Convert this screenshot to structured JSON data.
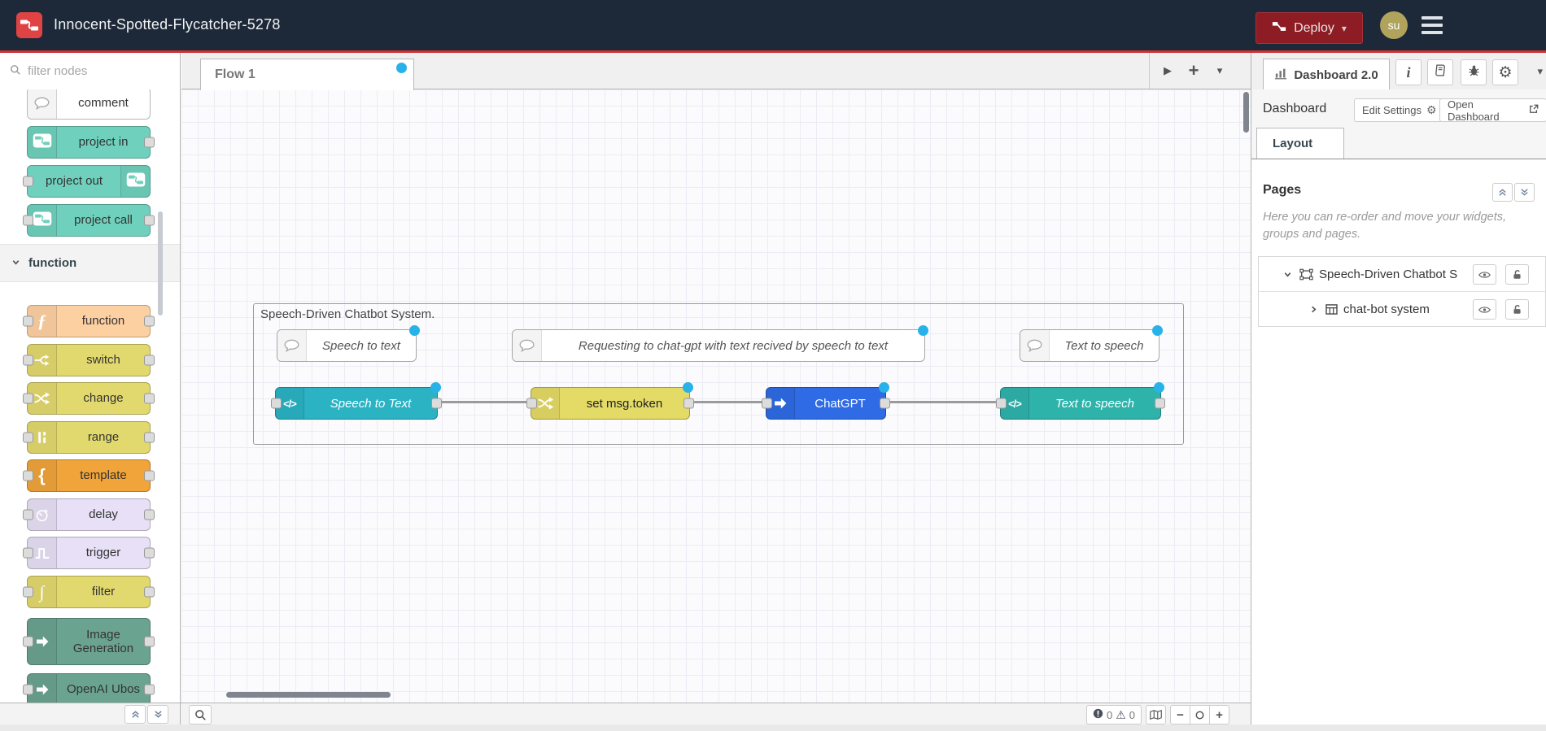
{
  "header": {
    "title": "Innocent-Spotted-Flycatcher-5278",
    "deploy_label": "Deploy",
    "avatar_initials": "su",
    "colors": {
      "bar": "#1d2939",
      "accent_red": "#cf3434",
      "deploy_bg": "#8e1c24"
    }
  },
  "palette": {
    "filter_placeholder": "filter nodes",
    "items": [
      {
        "label": "comment",
        "color": "#ffffff",
        "icon": "speech-bubble-icon",
        "icon_side": "left",
        "in": false,
        "out": false,
        "kind": "comment"
      },
      {
        "label": "project in",
        "color": "#6fd1bd",
        "icon": "node-red-icon",
        "icon_side": "left",
        "in": false,
        "out": true
      },
      {
        "label": "project out",
        "color": "#6fd1bd",
        "icon": "node-red-icon",
        "icon_side": "right",
        "in": true,
        "out": false
      },
      {
        "label": "project call",
        "color": "#6fd1bd",
        "icon": "node-red-icon",
        "icon_side": "left",
        "in": true,
        "out": true
      },
      {
        "header": "function"
      },
      {
        "label": "function",
        "color": "#fdd0a2",
        "icon": "function-icon",
        "icon_side": "left",
        "in": true,
        "out": true
      },
      {
        "label": "switch",
        "color": "#e2d96e",
        "icon": "switch-icon",
        "icon_side": "left",
        "in": true,
        "out": true
      },
      {
        "label": "change",
        "color": "#e2d96e",
        "icon": "change-icon",
        "icon_side": "left",
        "in": true,
        "out": true
      },
      {
        "label": "range",
        "color": "#e2d96e",
        "icon": "range-icon",
        "icon_side": "left",
        "in": true,
        "out": true
      },
      {
        "label": "template",
        "color": "#f0a43a",
        "icon": "template-icon",
        "icon_side": "left",
        "in": true,
        "out": true
      },
      {
        "label": "delay",
        "color": "#e7e0f6",
        "icon": "clock-icon",
        "icon_side": "left",
        "in": true,
        "out": true
      },
      {
        "label": "trigger",
        "color": "#e7e0f6",
        "icon": "pulse-icon",
        "icon_side": "left",
        "in": true,
        "out": true
      },
      {
        "label": "filter",
        "color": "#e2d96e",
        "icon": "filter-icon",
        "icon_side": "left",
        "in": true,
        "out": true
      },
      {
        "label": "Image Generation",
        "color": "#6ba391",
        "icon": "arrow-icon",
        "icon_side": "left",
        "in": true,
        "out": true
      },
      {
        "label": "OpenAI Ubos",
        "color": "#6ba391",
        "icon": "arrow-icon",
        "icon_side": "left",
        "in": true,
        "out": true
      }
    ]
  },
  "workspace": {
    "tabs": [
      {
        "label": "Flow 1",
        "dirty": true
      }
    ],
    "group_label": "Speech-Driven Chatbot System.",
    "comments": [
      {
        "label": "Speech to text"
      },
      {
        "label": "Requesting to chat-gpt with text recived by speech to text"
      },
      {
        "label": "Text to speech"
      }
    ],
    "nodes": [
      {
        "label": "Speech to Text",
        "color": "#2bb3c4",
        "icon": "code-icon",
        "italic": true,
        "text_color": "#ffffff"
      },
      {
        "label": "set msg.token",
        "color": "#e4da66",
        "icon": "change-icon",
        "italic": false,
        "text_color": "#222222"
      },
      {
        "label": "ChatGPT",
        "color": "#2f6be4",
        "icon": "arrow-icon",
        "italic": false,
        "text_color": "#ffffff"
      },
      {
        "label": "Text to speech",
        "color": "#2eb3ab",
        "icon": "code-icon",
        "italic": true,
        "text_color": "#ffffff"
      }
    ],
    "dirty_dot_color": "#29b2e8"
  },
  "sidebar": {
    "active_tab": "Dashboard 2.0",
    "section_title": "Dashboard",
    "edit_settings_label": "Edit Settings",
    "open_dashboard_label": "Open Dashboard",
    "layout_tab": "Layout",
    "pages_title": "Pages",
    "pages_description": "Here you can re-order and move your widgets, groups and pages.",
    "tree": [
      {
        "label": "Speech-Driven Chatbot S",
        "icon": "page-icon",
        "expanded": true,
        "level": 0
      },
      {
        "label": "chat-bot system",
        "icon": "table-icon",
        "expanded": false,
        "level": 1
      }
    ]
  },
  "statusbar": {
    "errors": "0",
    "warnings": "0"
  }
}
